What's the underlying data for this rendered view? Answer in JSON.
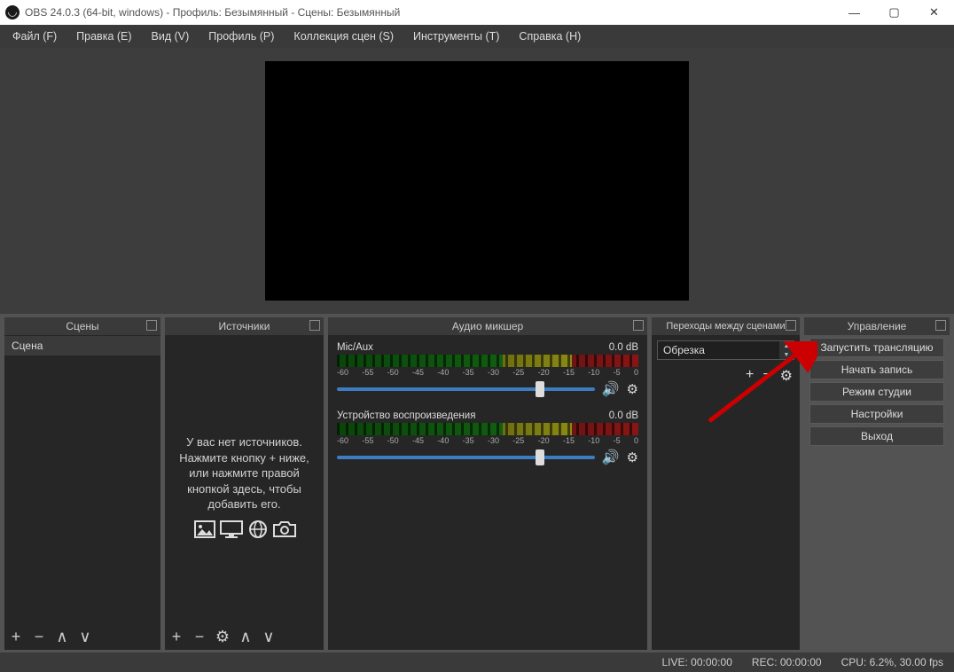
{
  "titlebar": {
    "text": "OBS 24.0.3 (64-bit, windows) - Профиль: Безымянный - Сцены: Безымянный"
  },
  "menu": {
    "file": "Файл (F)",
    "edit": "Правка (E)",
    "view": "Вид (V)",
    "profile": "Профиль (P)",
    "scenecol": "Коллекция сцен (S)",
    "tools": "Инструменты (T)",
    "help": "Справка (H)"
  },
  "panels": {
    "scenes": "Сцены",
    "sources": "Источники",
    "mixer": "Аудио микшер",
    "transitions": "Переходы между сценами",
    "controls": "Управление"
  },
  "scene_item": "Сцена",
  "sources_empty": {
    "l1": "У вас нет источников.",
    "l2": "Нажмите кнопку + ниже,",
    "l3": "или нажмите правой кнопкой здесь, чтобы добавить его."
  },
  "mixer": {
    "ch1": {
      "name": "Mic/Aux",
      "db": "0.0 dB"
    },
    "ch2": {
      "name": "Устройство воспроизведения",
      "db": "0.0 dB"
    },
    "ticks": [
      "-60",
      "-55",
      "-50",
      "-45",
      "-40",
      "-35",
      "-30",
      "-25",
      "-20",
      "-15",
      "-10",
      "-5",
      "0"
    ]
  },
  "transitions": {
    "selected": "Обрезка"
  },
  "controls": {
    "stream": "Запустить трансляцию",
    "record": "Начать запись",
    "studio": "Режим студии",
    "settings": "Настройки",
    "exit": "Выход"
  },
  "status": {
    "live": "LIVE: 00:00:00",
    "rec": "REC: 00:00:00",
    "cpu": "CPU: 6.2%, 30.00 fps"
  }
}
